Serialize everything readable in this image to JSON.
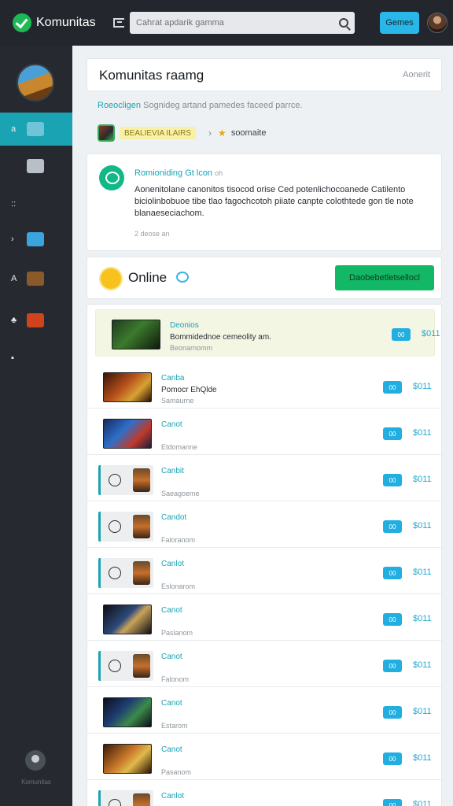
{
  "app": {
    "name": "Komunitas"
  },
  "search": {
    "placeholder": "Cahrat apdarik gamma"
  },
  "topbar": {
    "button_label": "Gemes"
  },
  "colors": {
    "accent": "#1aa3b3",
    "primary_button": "#29b6e8",
    "success": "#12b865",
    "sidebar_bg": "#262a30",
    "topbar_bg": "#23272d"
  },
  "sidebar": {
    "items": [
      {
        "small": "a",
        "icon": "photo-icon",
        "color": "#6fc5d7",
        "active": true
      },
      {
        "small": "",
        "icon": "building-icon",
        "color": "#b9bfc6",
        "active": false
      },
      {
        "small": "::",
        "icon": "",
        "color": "",
        "active": false
      },
      {
        "small": "›",
        "icon": "chat-icon",
        "color": "#3aa5dc",
        "active": false
      },
      {
        "small": "A",
        "icon": "game-tile-icon",
        "color": "#8b5a2b",
        "active": false
      },
      {
        "small": "♣",
        "icon": "game-tile-icon",
        "color": "#d1431c",
        "active": false
      },
      {
        "small": "▪",
        "icon": "",
        "color": "",
        "active": false
      }
    ],
    "footer_label": "Komunitas"
  },
  "main": {
    "page_title": "Komunitas raamg",
    "header_link": "Aonerit",
    "intro_highlight": "Roeocligen",
    "intro_text": "Sognideg artand pamedes faceed parrce.",
    "breadcrumb": {
      "tag": "BEALIEVIA ILAIRS",
      "label": "soomaite"
    }
  },
  "post": {
    "title": "Romioniding Gt lcon",
    "title_suffix": "oh",
    "body": "Aonenitolane canonitos tisocod orise Ced potenlichocoanede Catilento biciolinbobuoe tibe tlao fagochcotoh piiate canpte colothtede gon tle note blanaeseciachom.",
    "meta": "2 deose an"
  },
  "online": {
    "title": "Online",
    "button": "Daobebetletsellocl"
  },
  "rows": [
    {
      "title": "Deonios",
      "desc": "Bommidednoe cemeolity am.",
      "sub": "Beonarnomm",
      "pill": "00",
      "price": "$011",
      "style": "img",
      "bg": "linear-gradient(135deg,#1f3d1e,#3c7a2c 45%,#0f1a0e)"
    },
    {
      "title": "Canba",
      "desc": "Pomocr EhQlde",
      "sub": "Samaurne",
      "pill": "00",
      "price": "$011",
      "style": "img",
      "bg": "linear-gradient(135deg,#3a1408,#b8521c 45%,#d7a233 70%,#2b0f06)"
    },
    {
      "title": "Canot",
      "desc": "",
      "sub": "Etdomanne",
      "pill": "00",
      "price": "$011",
      "style": "img",
      "bg": "linear-gradient(135deg,#1a2a5e,#2d6fc9 40%,#c0392b 70%,#1b1d3a)"
    },
    {
      "title": "Canbit",
      "desc": "",
      "sub": "Saeagoeme",
      "pill": "00",
      "price": "$011",
      "style": "alt",
      "bg": "#eceeef"
    },
    {
      "title": "Candot",
      "desc": "",
      "sub": "Faloranom",
      "pill": "00",
      "price": "$011",
      "style": "alt",
      "bg": "#eceeef"
    },
    {
      "title": "Canlot",
      "desc": "",
      "sub": "Eslonarom",
      "pill": "00",
      "price": "$011",
      "style": "alt",
      "bg": "#eceeef"
    },
    {
      "title": "Canot",
      "desc": "",
      "sub": "Paslanom",
      "pill": "00",
      "price": "$011",
      "style": "img",
      "bg": "linear-gradient(135deg,#0c0e14,#2e4a7a 45%,#c9a35a 60%,#0c0e14)"
    },
    {
      "title": "Canot",
      "desc": "",
      "sub": "Falonom",
      "pill": "00",
      "price": "$011",
      "style": "alt",
      "bg": "#eceeef"
    },
    {
      "title": "Canot",
      "desc": "",
      "sub": "Estarom",
      "pill": "00",
      "price": "$011",
      "style": "img",
      "bg": "linear-gradient(135deg,#0b0f1a,#1f3f73 40%,#3c8a4a 65%,#0b0f1a)"
    },
    {
      "title": "Canot",
      "desc": "",
      "sub": "Pasanom",
      "pill": "00",
      "price": "$011",
      "style": "img",
      "bg": "linear-gradient(135deg,#3a1a08,#c9782a 45%,#e0b94a 65%,#2a1206)"
    },
    {
      "title": "Canlot",
      "desc": "",
      "sub": "",
      "pill": "00",
      "price": "$011",
      "style": "alt",
      "bg": "#eceeef"
    }
  ]
}
